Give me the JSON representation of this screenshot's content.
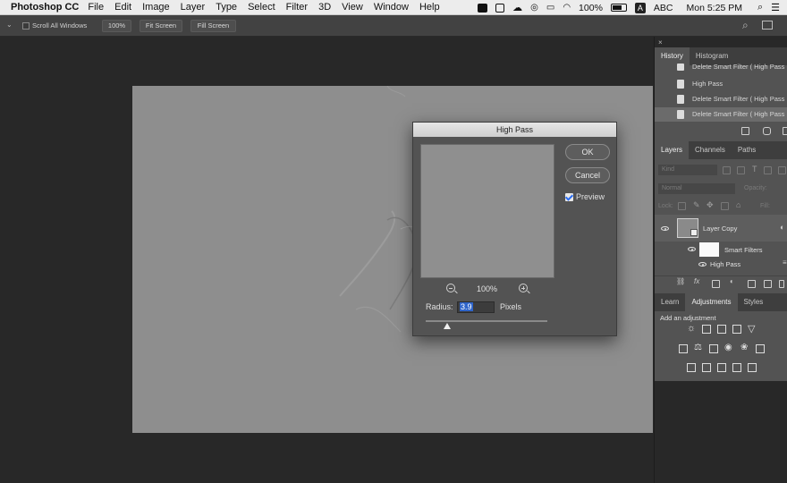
{
  "menubar": {
    "app_name": "Photoshop CC",
    "items": [
      "File",
      "Edit",
      "Image",
      "Layer",
      "Type",
      "Select",
      "Filter",
      "3D",
      "View",
      "Window",
      "Help"
    ],
    "battery": "100%",
    "input_source": "ABC",
    "clock": "Mon 5:25 PM"
  },
  "options_bar": {
    "scroll_all_windows": "Scroll All Windows",
    "zoom_btn": "100%",
    "fit_screen": "Fit Screen",
    "fill_screen": "Fill Screen"
  },
  "dialog": {
    "title": "High Pass",
    "ok": "OK",
    "cancel": "Cancel",
    "preview": "Preview",
    "zoom": "100%",
    "radius_label": "Radius:",
    "radius_value": "3.9",
    "radius_unit": "Pixels",
    "radius_fraction": 0.18
  },
  "history_panel": {
    "tabs": [
      "History",
      "Histogram"
    ],
    "items": [
      "Delete Smart Filter ( High Pass",
      "High Pass",
      "Delete Smart Filter ( High Pass",
      "Delete Smart Filter ( High Pass"
    ],
    "selected_index": 3
  },
  "layers_panel": {
    "tabs": [
      "Layers",
      "Channels",
      "Paths"
    ],
    "kind_placeholder": "Kind",
    "blend_mode": "Normal",
    "opacity_label": "Opacity:",
    "lock_label": "Lock:",
    "fill_label": "Fill:",
    "layer_name": "Layer Copy",
    "smart_filters": "Smart Filters",
    "filter_name": "High Pass"
  },
  "adjustments_panel": {
    "tabs": [
      "Learn",
      "Adjustments",
      "Styles"
    ],
    "heading": "Add an adjustment"
  }
}
